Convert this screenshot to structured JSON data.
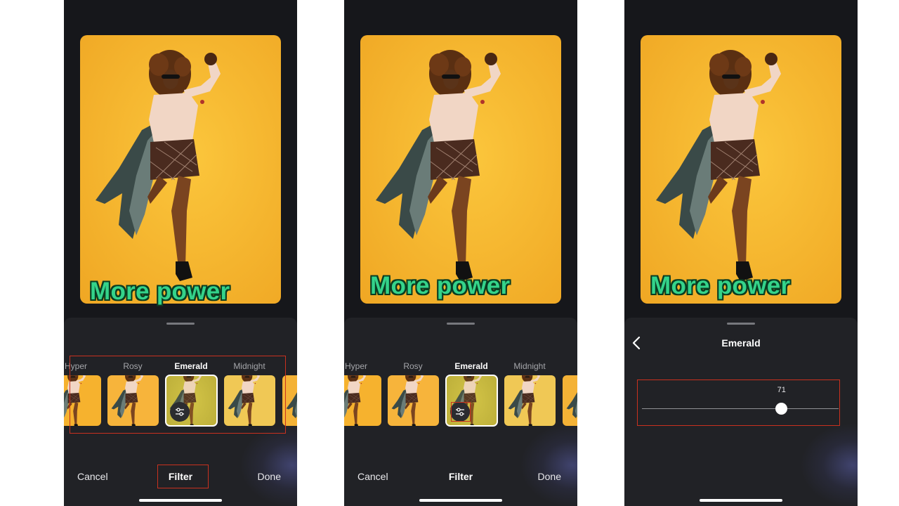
{
  "caption": "More power",
  "filters": [
    {
      "name": "Hyper"
    },
    {
      "name": "Rosy"
    },
    {
      "name": "Emerald"
    },
    {
      "name": "Midnight"
    }
  ],
  "selected_filter": "Emerald",
  "bottom_bar": {
    "cancel": "Cancel",
    "filter": "Filter",
    "done": "Done"
  },
  "adjust": {
    "title": "Emerald",
    "value": "71",
    "level": 71
  },
  "colors": {
    "background": "#16171b",
    "sheet": "#212226",
    "photo_bg": "#f6b731",
    "caption": "#34d38a",
    "highlight": "#c9311f"
  },
  "icons": {
    "adjust": "sliders-icon",
    "back": "chevron-left-icon"
  }
}
